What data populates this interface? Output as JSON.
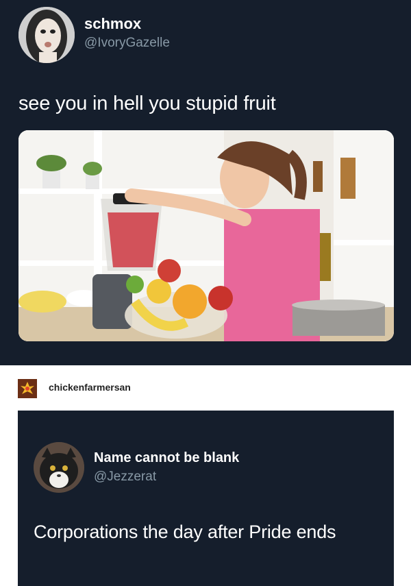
{
  "post1": {
    "display_name": "schmox",
    "handle": "@IvoryGazelle",
    "text": "see you in hell you stupid fruit"
  },
  "reblog": {
    "username": "chickenfarmersan"
  },
  "post2": {
    "display_name": "Name cannot be blank",
    "handle": "@Jezzerat",
    "text": "Corporations the day after Pride ends"
  },
  "colors": {
    "tweet_bg": "#151e2c",
    "text_primary": "#ffffff",
    "text_secondary": "#8899a6"
  }
}
